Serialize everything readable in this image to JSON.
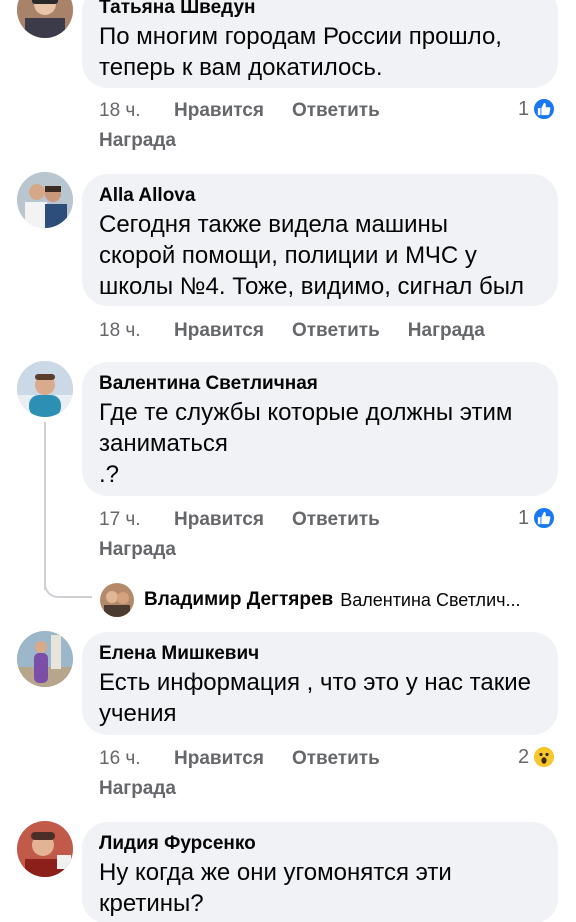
{
  "comments": [
    {
      "author": "Татьяна Шведун",
      "text_lines": [
        "По многим городам России прошло,",
        "теперь к вам докатилось."
      ],
      "time": "18 ч.",
      "like": "Нравится",
      "reply": "Ответить",
      "award": "Награда",
      "reaction_count": "1",
      "reaction_icon": "like-icon"
    },
    {
      "author": "Alla Allova",
      "text_lines": [
        "Сегодня также видела машины",
        "скорой помощи, полиции и МЧС у",
        "школы №4. Тоже, видимо, сигнал был"
      ],
      "time": "18 ч.",
      "like": "Нравится",
      "reply": "Ответить",
      "award": "Награда"
    },
    {
      "author": "Валентина Светличная",
      "text_lines": [
        "Где те службы которые должны этим",
        "заниматься",
        ".?"
      ],
      "time": "17 ч.",
      "like": "Нравится",
      "reply": "Ответить",
      "award": "Награда",
      "reaction_count": "1",
      "reaction_icon": "like-icon"
    },
    {
      "author": "Елена Мишкевич",
      "text_lines": [
        "Есть информация , что это у нас такие",
        "учения"
      ],
      "time": "16 ч.",
      "like": "Нравится",
      "reply": "Ответить",
      "award": "Награда",
      "reaction_count": "2",
      "reaction_icon": "wow-icon"
    },
    {
      "author": "Лидия Фурсенко",
      "text_lines": [
        "Ну когда же они угомонятся эти",
        "кретины?"
      ]
    }
  ],
  "reply_preview": {
    "author": "Владимир Дегтярев",
    "snippet": "Валентина Светлич..."
  },
  "colors": {
    "bubble": "#f0f2f5",
    "meta_text": "#65676b",
    "like_blue": "#1877f2",
    "wow_yellow": "#f7c62b"
  }
}
